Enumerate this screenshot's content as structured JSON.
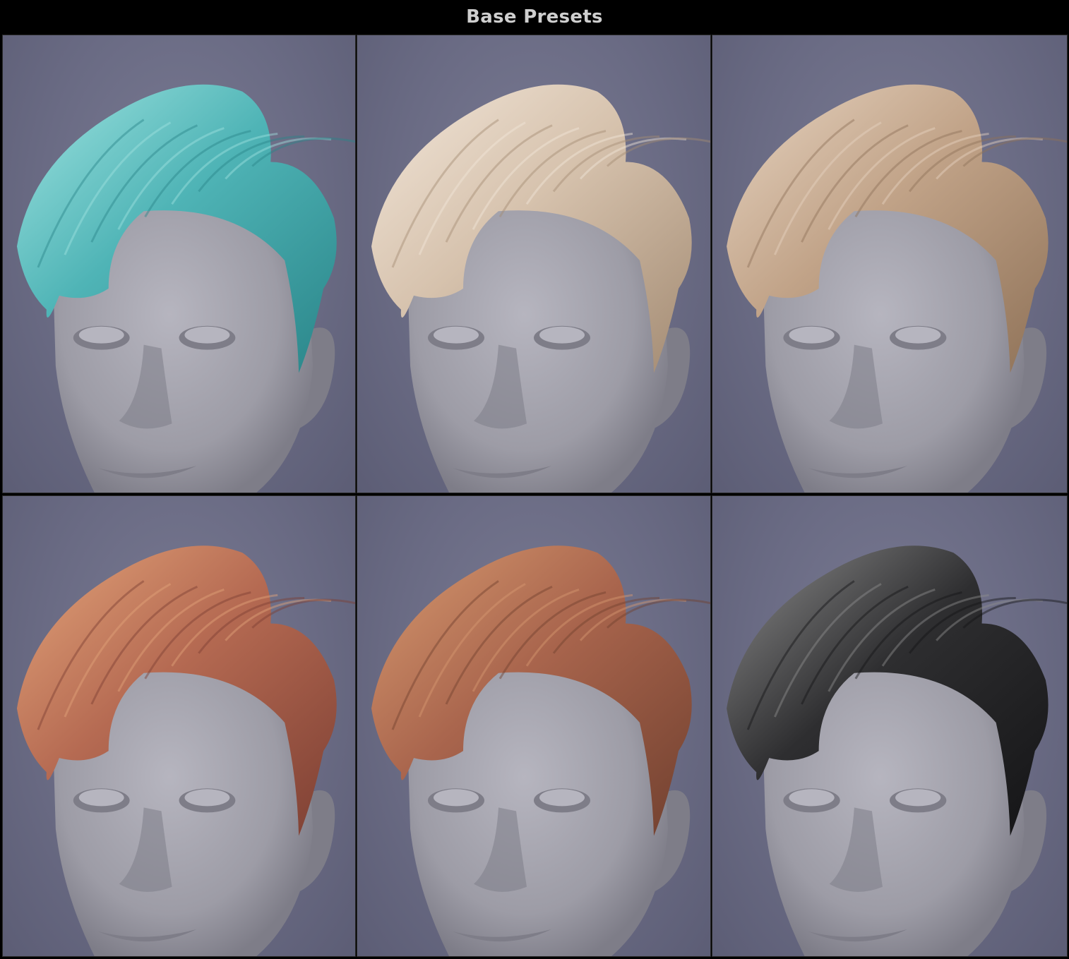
{
  "header": {
    "title": "Base Presets"
  },
  "presets": [
    {
      "hair_main": "#4fb4b6",
      "hair_light": "#9fe3e0",
      "hair_dark": "#2a8589"
    },
    {
      "hair_main": "#d6c2ad",
      "hair_light": "#f2e6d9",
      "hair_dark": "#a38b73"
    },
    {
      "hair_main": "#c1a388",
      "hair_light": "#e6d3c0",
      "hair_dark": "#8f7258"
    },
    {
      "hair_main": "#b56a52",
      "hair_light": "#e3a47a",
      "hair_dark": "#7d3f33"
    },
    {
      "hair_main": "#a9654d",
      "hair_light": "#d79a70",
      "hair_dark": "#71402f"
    },
    {
      "hair_main": "#2e2e30",
      "hair_light": "#8e8e8e",
      "hair_dark": "#141416"
    }
  ],
  "colors": {
    "skin": "#9d9ca6",
    "skin_shadow": "#7e7d88",
    "skin_highlight": "#b6b5bf"
  }
}
